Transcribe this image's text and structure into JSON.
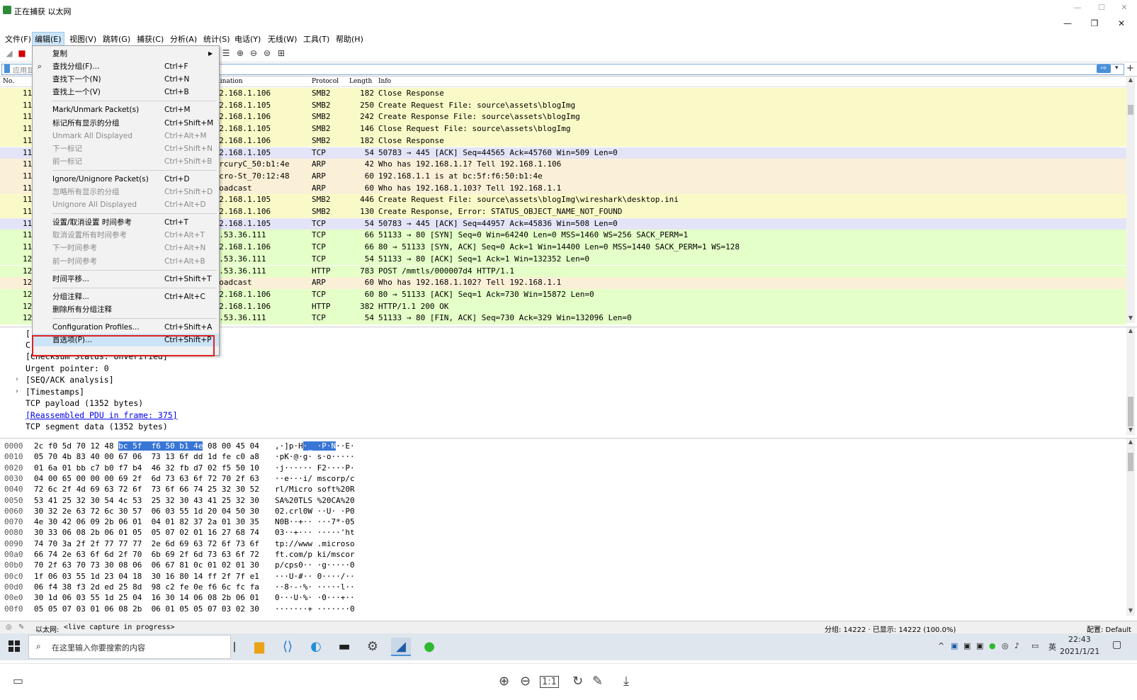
{
  "window": {
    "title": "正在捕获 以太网",
    "min": "—",
    "max": "☐",
    "close": "✕",
    "app_min": "—",
    "app_restore": "❐",
    "app_close": "✕"
  },
  "menubar": [
    {
      "label": "文件(F)"
    },
    {
      "label": "编辑(E)"
    },
    {
      "label": "视图(V)"
    },
    {
      "label": "跳转(G)"
    },
    {
      "label": "捕获(C)"
    },
    {
      "label": "分析(A)"
    },
    {
      "label": "统计(S)"
    },
    {
      "label": "电话(Y)"
    },
    {
      "label": "无线(W)"
    },
    {
      "label": "工具(T)"
    },
    {
      "label": "帮助(H)"
    }
  ],
  "filter": {
    "placeholder": "应用显",
    "go": "⇨",
    "dropdown": "▾",
    "plus": "+"
  },
  "packet_list": {
    "columns": {
      "no": "No.",
      "destination": "Destination",
      "protocol": "Protocol",
      "length": "Length",
      "info": "Info"
    },
    "rows": [
      {
        "no": "11",
        "dst": "192.168.1.106",
        "proto": "SMB2",
        "len": "182",
        "info": "Close Response",
        "cls": "c-smb"
      },
      {
        "no": "11",
        "dst": "192.168.1.105",
        "proto": "SMB2",
        "len": "250",
        "info": "Create Request File: source\\assets\\blogImg",
        "cls": "c-smb"
      },
      {
        "no": "11",
        "dst": "192.168.1.106",
        "proto": "SMB2",
        "len": "242",
        "info": "Create Response File: source\\assets\\blogImg",
        "cls": "c-smb"
      },
      {
        "no": "11",
        "dst": "192.168.1.105",
        "proto": "SMB2",
        "len": "146",
        "info": "Close Request File: source\\assets\\blogImg",
        "cls": "c-smb"
      },
      {
        "no": "11",
        "dst": "192.168.1.106",
        "proto": "SMB2",
        "len": "182",
        "info": "Close Response",
        "cls": "c-smb"
      },
      {
        "no": "11",
        "dst": "192.168.1.105",
        "proto": "TCP",
        "len": "54",
        "info": "50783 → 445 [ACK] Seq=44565 Ack=45760 Win=509 Len=0",
        "cls": "c-tcp"
      },
      {
        "no": "11",
        "dst": "MercuryC_50:b1:4e",
        "proto": "ARP",
        "len": "42",
        "info": "Who has 192.168.1.1? Tell 192.168.1.106",
        "cls": "c-arp"
      },
      {
        "no": "11",
        "dst": "Micro-St_70:12:48",
        "proto": "ARP",
        "len": "60",
        "info": "192.168.1.1 is at bc:5f:f6:50:b1:4e",
        "cls": "c-arp"
      },
      {
        "no": "11",
        "dst": "Broadcast",
        "proto": "ARP",
        "len": "60",
        "info": "Who has 192.168.1.103? Tell 192.168.1.1",
        "cls": "c-arp"
      },
      {
        "no": "11",
        "dst": "192.168.1.105",
        "proto": "SMB2",
        "len": "446",
        "info": "Create Request File: source\\assets\\blogImg\\wireshark\\desktop.ini",
        "cls": "c-smb"
      },
      {
        "no": "11",
        "dst": "192.168.1.106",
        "proto": "SMB2",
        "len": "130",
        "info": "Create Response, Error: STATUS_OBJECT_NAME_NOT_FOUND",
        "cls": "c-smb"
      },
      {
        "no": "11",
        "dst": "192.168.1.105",
        "proto": "TCP",
        "len": "54",
        "info": "50783 → 445 [ACK] Seq=44957 Ack=45836 Win=508 Len=0",
        "cls": "c-tcp"
      },
      {
        "no": "11",
        "dst": "42.53.36.111",
        "proto": "TCP",
        "len": "66",
        "info": "51133 → 80 [SYN] Seq=0 Win=64240 Len=0 MSS=1460 WS=256 SACK_PERM=1",
        "cls": "c-http"
      },
      {
        "no": "11",
        "dst": "192.168.1.106",
        "proto": "TCP",
        "len": "66",
        "info": "80 → 51133 [SYN, ACK] Seq=0 Ack=1 Win=14400 Len=0 MSS=1440 SACK_PERM=1 WS=128",
        "cls": "c-http"
      },
      {
        "no": "12",
        "dst": "42.53.36.111",
        "proto": "TCP",
        "len": "54",
        "info": "51133 → 80 [ACK] Seq=1 Ack=1 Win=132352 Len=0",
        "cls": "c-http"
      },
      {
        "no": "12",
        "dst": "42.53.36.111",
        "proto": "HTTP",
        "len": "783",
        "info": "POST /mmtls/000007d4 HTTP/1.1",
        "cls": "c-http"
      },
      {
        "no": "12",
        "dst": "Broadcast",
        "proto": "ARP",
        "len": "60",
        "info": "Who has 192.168.1.102? Tell 192.168.1.1",
        "cls": "c-arp"
      },
      {
        "no": "12",
        "dst": "192.168.1.106",
        "proto": "TCP",
        "len": "60",
        "info": "80 → 51133 [ACK] Seq=1 Ack=730 Win=15872 Len=0",
        "cls": "c-http"
      },
      {
        "no": "12",
        "dst": "192.168.1.106",
        "proto": "HTTP",
        "len": "382",
        "info": "HTTP/1.1 200 OK",
        "cls": "c-http"
      },
      {
        "no": "12",
        "dst": "42.53.36.111",
        "proto": "TCP",
        "len": "54",
        "info": "51133 → 80 [FIN, ACK] Seq=730 Ack=329 Win=132096 Len=0",
        "cls": "c-http"
      }
    ]
  },
  "details": {
    "lines": [
      {
        "text": "[Checksum Status: Unverified]",
        "exp": ""
      },
      {
        "text": "Urgent pointer: 0",
        "exp": ""
      },
      {
        "text": "[SEQ/ACK analysis]",
        "exp": "›"
      },
      {
        "text": "[Timestamps]",
        "exp": "›"
      },
      {
        "text": "TCP payload (1352 bytes)",
        "exp": ""
      },
      {
        "text": "[Reassembled PDU in frame: 375]",
        "exp": "",
        "link": true
      },
      {
        "text": "TCP segment data (1352 bytes)",
        "exp": ""
      }
    ],
    "partial_top": "[",
    "partial_c": "C"
  },
  "bytes": {
    "rows": [
      {
        "off": "0000",
        "hex_a": "2c f0 5d 70 12 48 ",
        "hex_hl": "bc 5f  f6 50 b1 4e",
        "hex_b": " 08 00 45 04",
        "asc_a": ",·]p·H",
        "asc_hl": "·_ ·P·N",
        "asc_b": "··E·"
      },
      {
        "off": "0010",
        "hex_a": "05 70 4b 83 40 00 67 06  73 13 6f dd 1d fe c0 a8",
        "asc_a": "·pK·@·g· s·o·····"
      },
      {
        "off": "0020",
        "hex_a": "01 6a 01 bb c7 b0 f7 b4  46 32 fb d7 02 f5 50 10",
        "asc_a": "·j······ F2····P·"
      },
      {
        "off": "0030",
        "hex_a": "04 00 65 00 00 00 69 2f  6d 73 63 6f 72 70 2f 63",
        "asc_a": "··e···i/ mscorp/c"
      },
      {
        "off": "0040",
        "hex_a": "72 6c 2f 4d 69 63 72 6f  73 6f 66 74 25 32 30 52",
        "asc_a": "rl/Micro soft%20R"
      },
      {
        "off": "0050",
        "hex_a": "53 41 25 32 30 54 4c 53  25 32 30 43 41 25 32 30",
        "asc_a": "SA%20TLS %20CA%20"
      },
      {
        "off": "0060",
        "hex_a": "30 32 2e 63 72 6c 30 57  06 03 55 1d 20 04 50 30",
        "asc_a": "02.crl0W ··U· ·P0"
      },
      {
        "off": "0070",
        "hex_a": "4e 30 42 06 09 2b 06 01  04 01 82 37 2a 01 30 35",
        "asc_a": "N0B··+·· ···7*·05"
      },
      {
        "off": "0080",
        "hex_a": "30 33 06 08 2b 06 01 05  05 07 02 01 16 27 68 74",
        "asc_a": "03··+··· ·····'ht"
      },
      {
        "off": "0090",
        "hex_a": "74 70 3a 2f 2f 77 77 77  2e 6d 69 63 72 6f 73 6f",
        "asc_a": "tp://www .microso"
      },
      {
        "off": "00a0",
        "hex_a": "66 74 2e 63 6f 6d 2f 70  6b 69 2f 6d 73 63 6f 72",
        "asc_a": "ft.com/p ki/mscor"
      },
      {
        "off": "00b0",
        "hex_a": "70 2f 63 70 73 30 08 06  06 67 81 0c 01 02 01 30",
        "asc_a": "p/cps0·· ·g·····0"
      },
      {
        "off": "00c0",
        "hex_a": "1f 06 03 55 1d 23 04 18  30 16 80 14 ff 2f 7f e1",
        "asc_a": "···U·#·· 0····/··"
      },
      {
        "off": "00d0",
        "hex_a": "06 f4 38 f3 2d ed 25 8d  98 c2 fe 0e f6 6c fc fa",
        "asc_a": "··8·-·%· ·····l··"
      },
      {
        "off": "00e0",
        "hex_a": "30 1d 06 03 55 1d 25 04  16 30 14 06 08 2b 06 01",
        "asc_a": "0···U·%· ·0···+··"
      },
      {
        "off": "00f0",
        "hex_a": "05 05 07 03 01 06 08 2b  06 01 05 05 07 03 02 30",
        "asc_a": "·······+ ·······0"
      }
    ]
  },
  "statusbar": {
    "iface": "以太网:",
    "capture": "<live capture in progress>",
    "stats": "分组: 14222 · 已显示: 14222 (100.0%)",
    "profile": "配置: Default"
  },
  "edit_menu": {
    "items": [
      {
        "label": "复制",
        "key": "",
        "submenu": true,
        "disabled": false,
        "sep_before": false
      },
      {
        "label": "查找分组(F)...",
        "key": "Ctrl+F",
        "disabled": false,
        "icon": true
      },
      {
        "label": "查找下一个(N)",
        "key": "Ctrl+N",
        "disabled": false
      },
      {
        "label": "查找上一个(V)",
        "key": "Ctrl+B",
        "disabled": false
      },
      {
        "label": "Mark/Unmark Packet(s)",
        "key": "Ctrl+M",
        "disabled": false,
        "sep_before": true
      },
      {
        "label": "标记所有显示的分组",
        "key": "Ctrl+Shift+M",
        "disabled": false
      },
      {
        "label": "Unmark All Displayed",
        "key": "Ctrl+Alt+M",
        "disabled": true
      },
      {
        "label": "下一标记",
        "key": "Ctrl+Shift+N",
        "disabled": true
      },
      {
        "label": "前一标记",
        "key": "Ctrl+Shift+B",
        "disabled": true
      },
      {
        "label": "Ignore/Unignore Packet(s)",
        "key": "Ctrl+D",
        "disabled": false,
        "sep_before": true
      },
      {
        "label": "忽略所有显示的分组",
        "key": "Ctrl+Shift+D",
        "disabled": true
      },
      {
        "label": "Unignore All Displayed",
        "key": "Ctrl+Alt+D",
        "disabled": true
      },
      {
        "label": "设置/取消设置 时间参考",
        "key": "Ctrl+T",
        "disabled": false,
        "sep_before": true
      },
      {
        "label": "取消设置所有时间参考",
        "key": "Ctrl+Alt+T",
        "disabled": true
      },
      {
        "label": "下一时间参考",
        "key": "Ctrl+Alt+N",
        "disabled": true
      },
      {
        "label": "前一时间参考",
        "key": "Ctrl+Alt+B",
        "disabled": true
      },
      {
        "label": "时间平移...",
        "key": "Ctrl+Shift+T",
        "disabled": false,
        "sep_before": true
      },
      {
        "label": "分组注释...",
        "key": "Ctrl+Alt+C",
        "disabled": false,
        "sep_before": true
      },
      {
        "label": "删除所有分组注释",
        "key": "",
        "disabled": false
      },
      {
        "label": "Configuration Profiles...",
        "key": "Ctrl+Shift+A",
        "disabled": false,
        "sep_before": true
      },
      {
        "label": "首选项(P)...",
        "key": "Ctrl+Shift+P",
        "disabled": false,
        "hover": true
      }
    ]
  },
  "taskbar": {
    "search_placeholder": "在这里输入你要搜索的内容",
    "ime": "英",
    "time": "22:43",
    "date": "2021/1/21"
  }
}
